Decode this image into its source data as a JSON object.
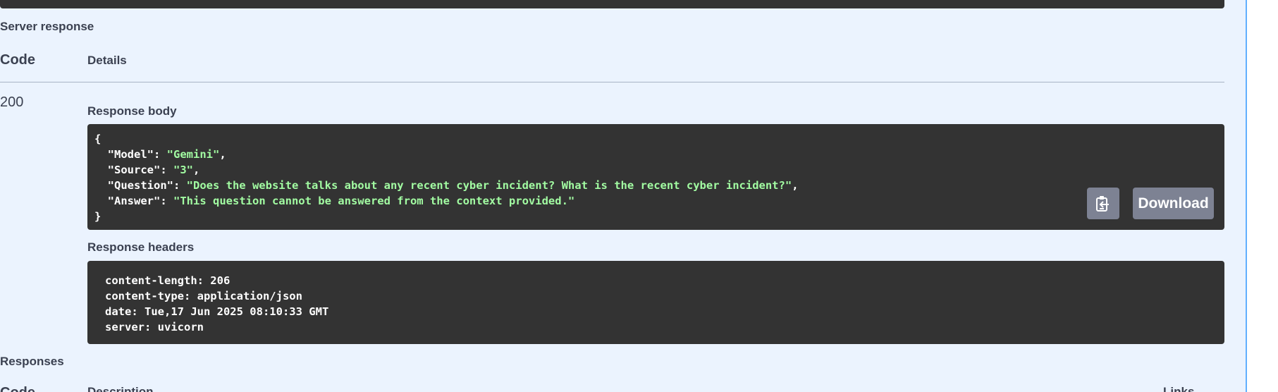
{
  "server_response": {
    "title": "Server response",
    "columns": {
      "code": "Code",
      "details": "Details"
    },
    "status_code": "200",
    "response_body": {
      "title": "Response body",
      "lines": [
        {
          "plain": "{"
        },
        {
          "key": "  \"Model\"",
          "sep": ": ",
          "value": "\"Gemini\"",
          "end": ","
        },
        {
          "key": "  \"Source\"",
          "sep": ": ",
          "value": "\"3\"",
          "end": ","
        },
        {
          "key": "  \"Question\"",
          "sep": ": ",
          "value": "\"Does the website talks about any recent cyber incident? What is the recent cyber incident?\"",
          "end": ","
        },
        {
          "key": "  \"Answer\"",
          "sep": ": ",
          "value": "\"This question cannot be answered from the context provided.\"",
          "end": ""
        },
        {
          "plain": "}"
        }
      ],
      "copy_icon": "clipboard-copy-icon",
      "download_label": "Download"
    },
    "response_headers": {
      "title": "Response headers",
      "lines": [
        "content-length: 206",
        "content-type: application/json",
        "date: Tue,17 Jun 2025 08:10:33 GMT",
        "server: uvicorn"
      ]
    }
  },
  "responses": {
    "title": "Responses",
    "columns": {
      "code": "Code",
      "description": "Description",
      "links": "Links"
    }
  },
  "colors": {
    "panel_bg": "#ebf3fe",
    "panel_border": "#61affe",
    "code_bg": "#333333",
    "string": "#a2fca2",
    "button_bg": "#7d8293",
    "text": "#3b4151"
  }
}
